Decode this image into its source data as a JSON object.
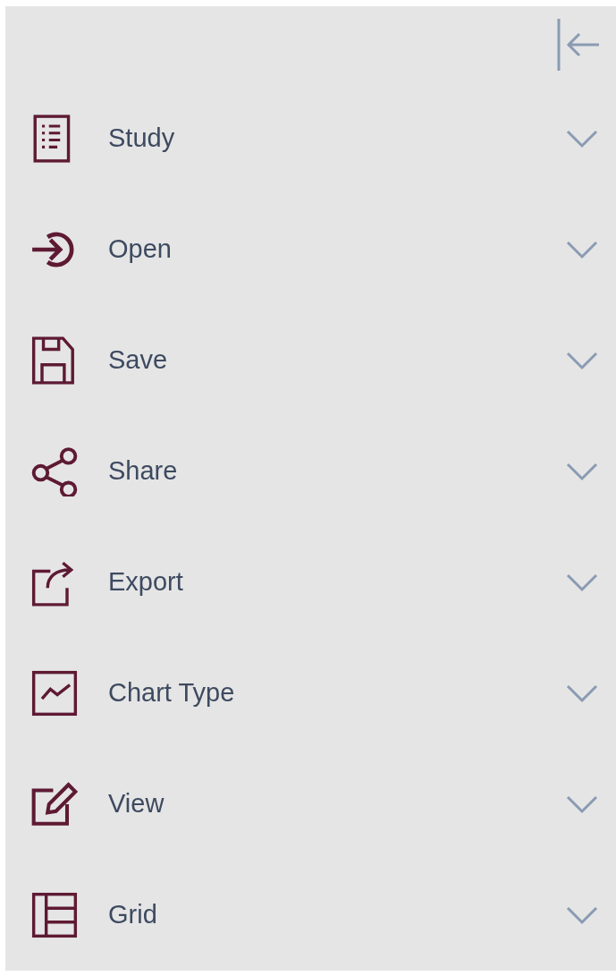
{
  "items": [
    {
      "label": "Study",
      "expanded": false
    },
    {
      "label": "Open",
      "expanded": false
    },
    {
      "label": "Save",
      "expanded": false
    },
    {
      "label": "Share",
      "expanded": false
    },
    {
      "label": "Export",
      "expanded": false
    },
    {
      "label": "Chart Type",
      "expanded": false
    },
    {
      "label": "View",
      "expanded": false
    },
    {
      "label": "Grid",
      "expanded": false
    }
  ]
}
